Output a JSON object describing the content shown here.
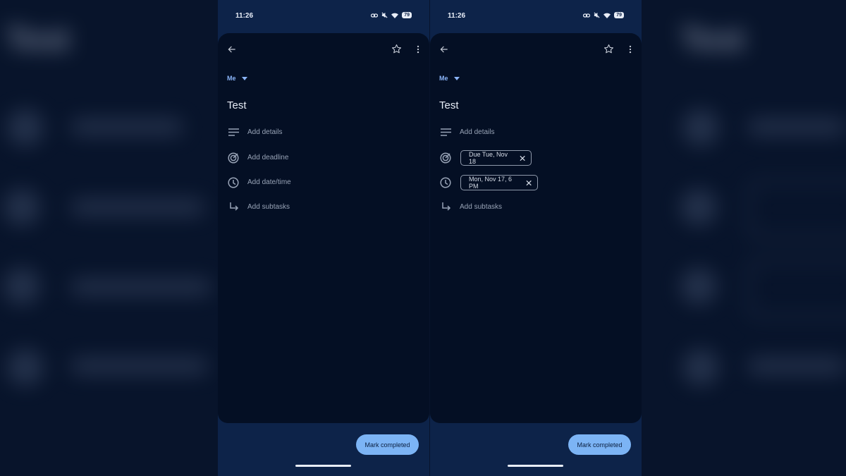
{
  "background": {
    "title": "Test",
    "chips": [
      "Due Tue",
      "Mon, N"
    ]
  },
  "screens": [
    {
      "status": {
        "time": "11:26",
        "battery": "79"
      },
      "header": {
        "back_icon": "arrow-left-icon",
        "star_icon": "star-outline-icon",
        "menu_icon": "more-vert-icon"
      },
      "assignee": "Me",
      "task_title": "Test",
      "rows": {
        "details": "Add details",
        "deadline": "Add deadline",
        "datetime": "Add date/time",
        "subtasks": "Add subtasks"
      },
      "action": "Mark completed"
    },
    {
      "status": {
        "time": "11:26",
        "battery": "79"
      },
      "header": {
        "back_icon": "arrow-left-icon",
        "star_icon": "star-outline-icon",
        "menu_icon": "more-vert-icon"
      },
      "assignee": "Me",
      "task_title": "Test",
      "rows": {
        "details": "Add details",
        "deadline_chip": "Due Tue, Nov 18",
        "datetime_chip": "Mon, Nov 17, 6 PM",
        "subtasks": "Add subtasks"
      },
      "action": "Mark completed"
    }
  ],
  "colors": {
    "accent": "#8ab4f8",
    "button": "#7cb4f5",
    "card": "#040f24",
    "frame": "#0d2349"
  }
}
